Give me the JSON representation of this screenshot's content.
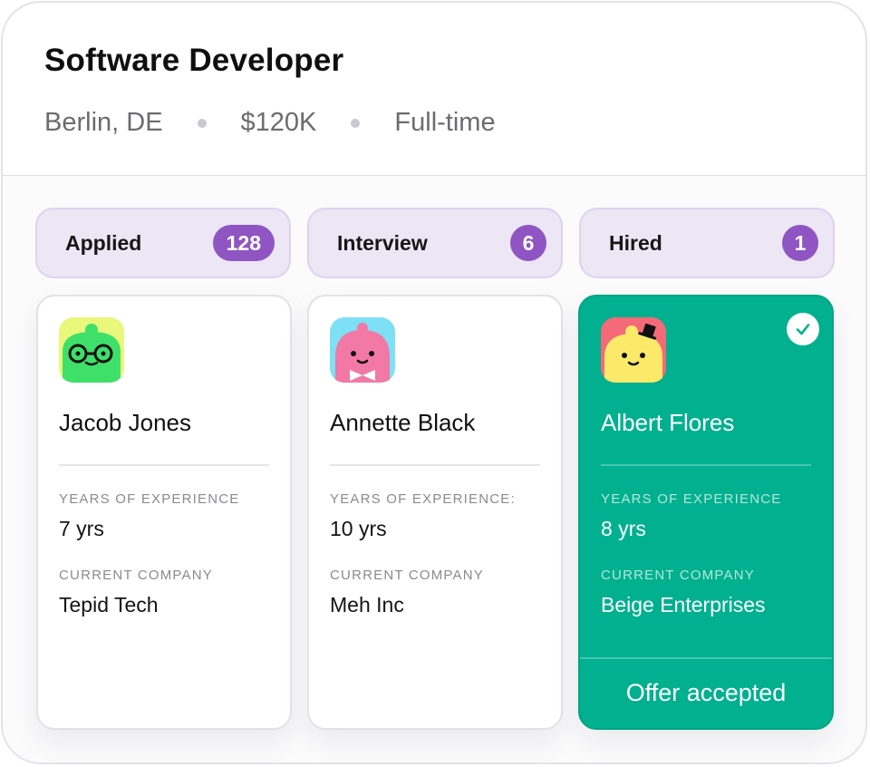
{
  "job": {
    "title": "Software Developer",
    "location": "Berlin, DE",
    "salary": "$120K",
    "type": "Full-time"
  },
  "columns": [
    {
      "label": "Applied",
      "count": "128"
    },
    {
      "label": "Interview",
      "count": "6"
    },
    {
      "label": "Hired",
      "count": "1"
    }
  ],
  "candidates": [
    {
      "name": "Jacob Jones",
      "experience_label": "YEARS OF EXPERIENCE",
      "experience": "7 yrs",
      "company_label": "CURRENT COMPANY",
      "company": "Tepid Tech",
      "avatar_icon": "green-monster-glasses-avatar"
    },
    {
      "name": "Annette Black",
      "experience_label": "YEARS OF EXPERIENCE:",
      "experience": "10 yrs",
      "company_label": "CURRENT COMPANY",
      "company": "Meh Inc",
      "avatar_icon": "pink-monster-bowtie-avatar"
    },
    {
      "name": "Albert Flores",
      "experience_label": "YEARS OF EXPERIENCE",
      "experience": "8 yrs",
      "company_label": "CURRENT COMPANY",
      "company": "Beige Enterprises",
      "avatar_icon": "yellow-monster-tophat-avatar",
      "status": "Offer accepted",
      "status_icon": "checkmark-icon"
    }
  ],
  "colors": {
    "accent_purple": "#8f55c2",
    "column_bg": "#ece6f5",
    "hired_green": "#00b08f"
  }
}
